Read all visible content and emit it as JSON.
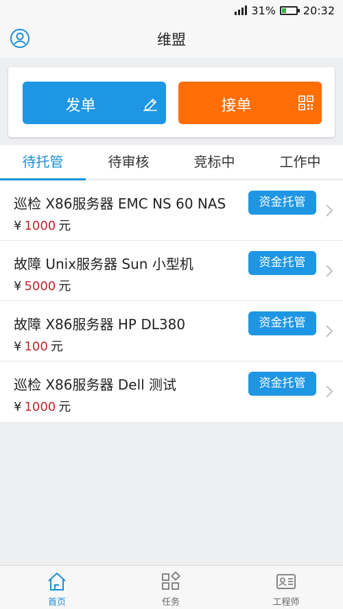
{
  "status_bar": {
    "battery": "31%",
    "battery_level": 0.31,
    "time": "20:32"
  },
  "header": {
    "title": "维盟",
    "left_icon": "user-icon"
  },
  "actions": {
    "post_label": "发单",
    "post_icon": "pencil-icon",
    "take_label": "接单",
    "take_icon": "scan-icon",
    "post_color": "#1e96e4",
    "take_color": "#ff6d05"
  },
  "tabs": [
    {
      "label": "待托管",
      "active": true
    },
    {
      "label": "待审核",
      "active": false
    },
    {
      "label": "竞标中",
      "active": false
    },
    {
      "label": "工作中",
      "active": false
    }
  ],
  "orders": [
    {
      "title": "巡检 X86服务器 EMC NS 60 NAS",
      "currency": "¥",
      "amount": "1000",
      "unit": "元",
      "badge": "资金托管"
    },
    {
      "title": "故障 Unix服务器 Sun 小型机",
      "currency": "¥",
      "amount": "5000",
      "unit": "元",
      "badge": "资金托管"
    },
    {
      "title": "故障 X86服务器 HP DL380",
      "currency": "¥",
      "amount": "100",
      "unit": "元",
      "badge": "资金托管"
    },
    {
      "title": "巡检 X86服务器 Dell 测试",
      "currency": "¥",
      "amount": "1000",
      "unit": "元",
      "badge": "资金托管"
    }
  ],
  "bottom_nav": [
    {
      "label": "首页",
      "icon": "home-icon",
      "active": true
    },
    {
      "label": "任务",
      "icon": "tasks-icon",
      "active": false
    },
    {
      "label": "工程师",
      "icon": "engineer-card-icon",
      "active": false
    }
  ],
  "colors": {
    "accent": "#1a8ed8",
    "price": "#c0272d"
  }
}
